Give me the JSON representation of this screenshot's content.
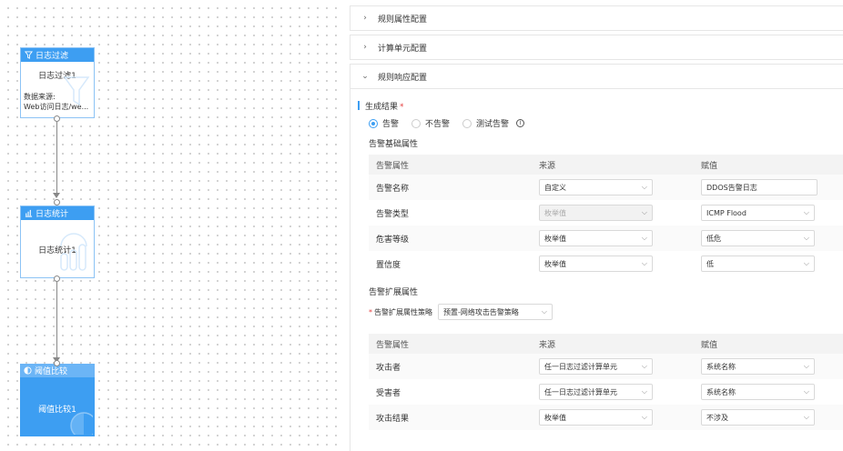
{
  "canvas": {
    "nodes": [
      {
        "header": "日志过滤",
        "title": "日志过滤1",
        "line1": "数据来源:",
        "line2": "Web访问日志/we..."
      },
      {
        "header": "日志统计",
        "title": "日志统计1"
      },
      {
        "header": "阈值比较",
        "title": "阈值比较1"
      }
    ]
  },
  "panel": {
    "sections": [
      "规则属性配置",
      "计算单元配置",
      "规则响应配置"
    ],
    "result_label": "生成结果",
    "required_mark": "*",
    "radios": [
      "告警",
      "不告警",
      "测试告警"
    ],
    "info_glyph": "i",
    "basic_title": "告警基础属性",
    "headers": [
      "告警属性",
      "来源",
      "赋值"
    ],
    "basic_rows": [
      {
        "attr": "告警名称",
        "source": "自定义",
        "value": "DDOS告警日志"
      },
      {
        "attr": "告警类型",
        "source": "枚举值",
        "value": "ICMP Flood"
      },
      {
        "attr": "危害等级",
        "source": "枚举值",
        "value": "低危"
      },
      {
        "attr": "置信度",
        "source": "枚举值",
        "value": "低"
      }
    ],
    "ext_title": "告警扩展属性",
    "ext_policy_label": "告警扩展属性策略",
    "ext_policy_value": "预置-网络攻击告警策略",
    "ext_rows": [
      {
        "attr": "攻击者",
        "source": "任一日志过滤计算单元",
        "value": "系统名称"
      },
      {
        "attr": "受害者",
        "source": "任一日志过滤计算单元",
        "value": "系统名称"
      },
      {
        "attr": "攻击结果",
        "source": "枚举值",
        "value": "不涉及"
      }
    ],
    "chevron_right": "›",
    "chevron_down": "⌄",
    "select_chev": "⌵"
  },
  "colors": {
    "accent": "#3d9ef2",
    "node_border": "#8cc3f5"
  }
}
